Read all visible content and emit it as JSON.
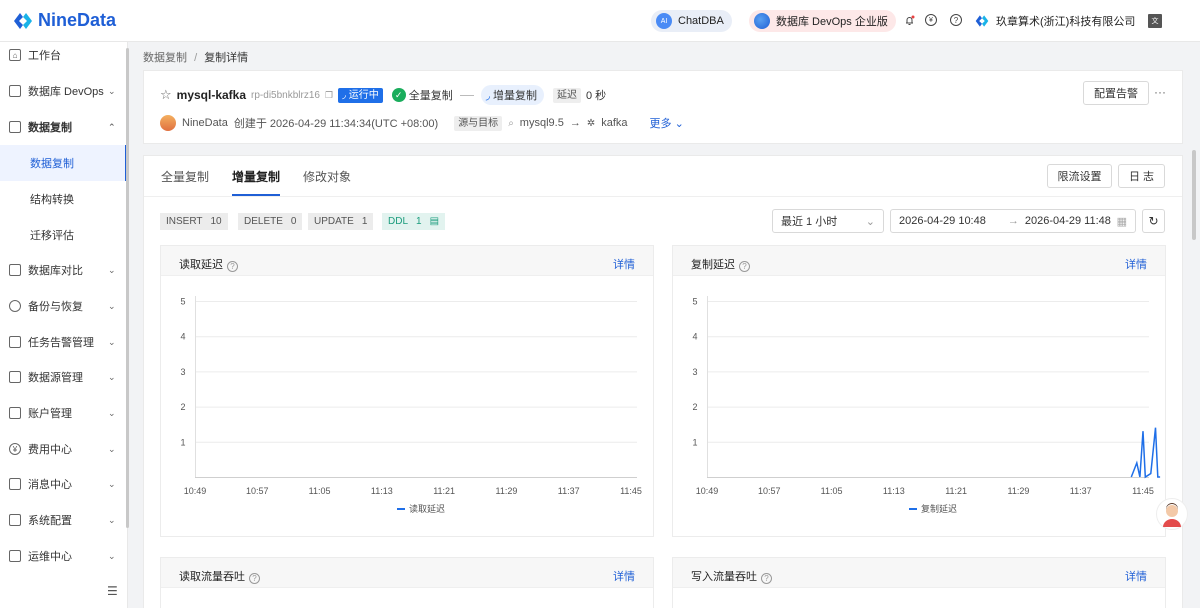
{
  "brand": {
    "name": "NineData"
  },
  "topbar": {
    "chatdba": "ChatDBA",
    "edition": "数据库 DevOps 企业版",
    "company": "玖章算术(浙江)科技有限公司"
  },
  "sidebar": {
    "items": [
      {
        "label": "工作台"
      },
      {
        "label": "数据库 DevOps"
      },
      {
        "label": "数据复制"
      },
      {
        "label": "数据库对比"
      },
      {
        "label": "备份与恢复"
      },
      {
        "label": "任务告警管理"
      },
      {
        "label": "数据源管理"
      },
      {
        "label": "账户管理"
      },
      {
        "label": "费用中心"
      },
      {
        "label": "消息中心"
      },
      {
        "label": "系统配置"
      },
      {
        "label": "运维中心"
      }
    ],
    "subitems": [
      {
        "label": "数据复制"
      },
      {
        "label": "结构转换"
      },
      {
        "label": "迁移评估"
      }
    ]
  },
  "breadcrumb": {
    "parent": "数据复制",
    "sep": "/",
    "current": "复制详情"
  },
  "task": {
    "name": "mysql-kafka",
    "id": "rp-di5bnkblrz16",
    "status": "运行中",
    "full_label": "全量复制",
    "incr_label": "增量复制",
    "delay_label": "延迟",
    "delay_value": "0 秒",
    "creator": "NineData",
    "created": "创建于 2026-04-29 11:34:34(UTC +08:00)",
    "src_target_label": "源与目标",
    "source": "mysql9.5",
    "target": "kafka",
    "more": "更多",
    "config_alert": "配置告警"
  },
  "tabs": [
    {
      "label": "全量复制"
    },
    {
      "label": "增量复制"
    },
    {
      "label": "修改对象"
    }
  ],
  "buttons": {
    "rate_limit": "限流设置",
    "log": "日 志"
  },
  "stats": [
    {
      "name": "INSERT",
      "value": "10"
    },
    {
      "name": "DELETE",
      "value": "0"
    },
    {
      "name": "UPDATE",
      "value": "1"
    },
    {
      "name": "DDL",
      "value": "1"
    }
  ],
  "time_filter": {
    "range": "最近 1 小时",
    "start": "2026-04-29 10:48",
    "end": "2026-04-29 11:48"
  },
  "detail_label": "详情",
  "chart_data": [
    {
      "type": "line",
      "title": "读取延迟",
      "x": [
        "10:49",
        "10:57",
        "11:05",
        "11:13",
        "11:21",
        "11:29",
        "11:37",
        "11:45"
      ],
      "yticks": [
        1,
        2,
        3,
        4,
        5
      ],
      "ylim": [
        0,
        5
      ],
      "series": [
        {
          "name": "读取延迟",
          "values": []
        }
      ],
      "legend": "bottom-center",
      "grid": true
    },
    {
      "type": "line",
      "title": "复制延迟",
      "x": [
        "10:49",
        "10:57",
        "11:05",
        "11:13",
        "11:21",
        "11:29",
        "11:37",
        "11:45"
      ],
      "yticks": [
        1,
        2,
        3,
        4,
        5
      ],
      "ylim": [
        0,
        5
      ],
      "series": [
        {
          "name": "复制延迟",
          "values": [
            {
              "t": "11:43.5",
              "y": 0
            },
            {
              "t": "11:44.2",
              "y": 0.4
            },
            {
              "t": "11:44.6",
              "y": 0
            },
            {
              "t": "11:45.0",
              "y": 1.3
            },
            {
              "t": "11:45.3",
              "y": 0
            },
            {
              "t": "11:46.0",
              "y": 0.1
            },
            {
              "t": "11:46.6",
              "y": 1.4
            },
            {
              "t": "11:46.9",
              "y": 0
            },
            {
              "t": "11:47.2",
              "y": 0
            }
          ]
        }
      ],
      "legend": "bottom-center",
      "grid": true
    },
    {
      "type": "line",
      "title": "读取流量吞吐"
    },
    {
      "type": "line",
      "title": "写入流量吞吐"
    }
  ]
}
